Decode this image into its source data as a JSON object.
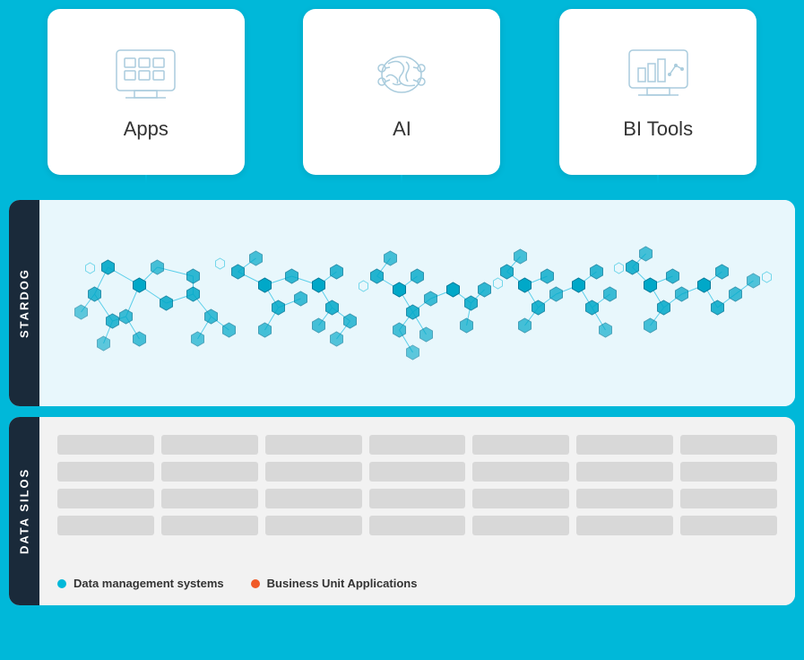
{
  "background_color": "#00b8d9",
  "cards": [
    {
      "id": "apps",
      "label": "Apps",
      "icon": "apps-icon"
    },
    {
      "id": "ai",
      "label": "AI",
      "icon": "ai-icon"
    },
    {
      "id": "bi-tools",
      "label": "BI Tools",
      "icon": "bi-tools-icon"
    }
  ],
  "stardog_section": {
    "label": "STARDOG",
    "description": "Knowledge graph network"
  },
  "data_silos_section": {
    "label": "DATA SILOS",
    "legend": [
      {
        "id": "data-management",
        "color": "blue",
        "text": "Data management systems"
      },
      {
        "id": "business-unit",
        "color": "orange",
        "text": "Business Unit Applications"
      }
    ]
  }
}
